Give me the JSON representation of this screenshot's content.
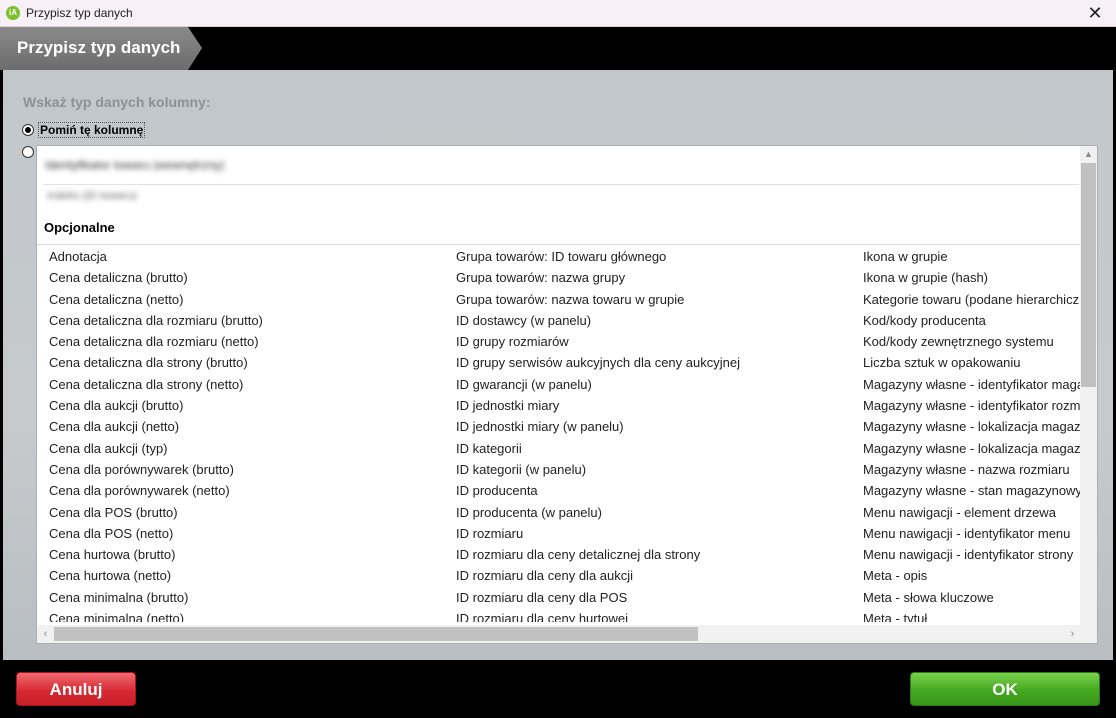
{
  "window": {
    "title": "Przypisz typ danych",
    "close_glyph": "✕",
    "app_icon": "app-logo-icon",
    "app_icon_glyph": "iA"
  },
  "header": {
    "title": "Przypisz typ danych"
  },
  "section": {
    "title": "Wskaż typ danych kolumny:"
  },
  "options": {
    "skip_label": "Pomiń tę kolumnę",
    "skip_selected": true,
    "blurred_primary": "Identyfikator towaru (wewnętrzny)",
    "blurred_secondary": "Indeks (ID towaru)"
  },
  "list": {
    "group_heading": "Opcjonalne",
    "columns": [
      [
        "Adnotacja",
        "Cena detaliczna (brutto)",
        "Cena detaliczna (netto)",
        "Cena detaliczna dla rozmiaru (brutto)",
        "Cena detaliczna dla rozmiaru (netto)",
        "Cena detaliczna dla strony (brutto)",
        "Cena detaliczna dla strony (netto)",
        "Cena dla aukcji (brutto)",
        "Cena dla aukcji (netto)",
        "Cena dla aukcji (typ)",
        "Cena dla porównywarek (brutto)",
        "Cena dla porównywarek (netto)",
        "Cena dla POS (brutto)",
        "Cena dla POS (netto)",
        "Cena hurtowa (brutto)",
        "Cena hurtowa (netto)",
        "Cena minimalna (brutto)",
        "Cena minimalna (netto)"
      ],
      [
        "Grupa towarów: ID towaru głównego",
        "Grupa towarów: nazwa grupy",
        "Grupa towarów: nazwa towaru w grupie",
        "ID dostawcy (w panelu)",
        "ID grupy rozmiarów",
        "ID grupy serwisów aukcyjnych dla ceny aukcyjnej",
        "ID gwarancji (w panelu)",
        "ID jednostki miary",
        "ID jednostki miary (w panelu)",
        "ID kategorii",
        "ID kategorii (w panelu)",
        "ID producenta",
        "ID producenta (w panelu)",
        "ID rozmiaru",
        "ID rozmiaru dla ceny detalicznej dla strony",
        "ID rozmiaru dla ceny dla aukcji",
        "ID rozmiaru dla ceny dla POS",
        "ID rozmiaru dla ceny hurtowej"
      ],
      [
        "Ikona w grupie",
        "Ikona w grupie (hash)",
        "Kategorie towaru (podane hierarchicznie)",
        "Kod/kody producenta",
        "Kod/kody zewnętrznego systemu",
        "Liczba sztuk w opakowaniu",
        "Magazyny własne - identyfikator magazynu",
        "Magazyny własne - identyfikator rozmiaru",
        "Magazyny własne - lokalizacja magazynowa",
        "Magazyny własne - lokalizacja magazynowa (ID)",
        "Magazyny własne - nazwa rozmiaru",
        "Magazyny własne - stan magazynowy",
        "Menu nawigacji - element drzewa",
        "Menu nawigacji - identyfikator menu",
        "Menu nawigacji - identyfikator strony",
        "Meta - opis",
        "Meta - słowa kluczowe",
        "Meta - tytuł"
      ]
    ]
  },
  "scroll_glyphs": {
    "up": "▲",
    "left": "‹",
    "right": "›"
  },
  "buttons": {
    "cancel": "Anuluj",
    "ok": "OK"
  },
  "colors": {
    "cancel": "#d62a33",
    "ok": "#44a81f",
    "header_bg": "#000000",
    "header_tab": "#7a7a7a"
  }
}
